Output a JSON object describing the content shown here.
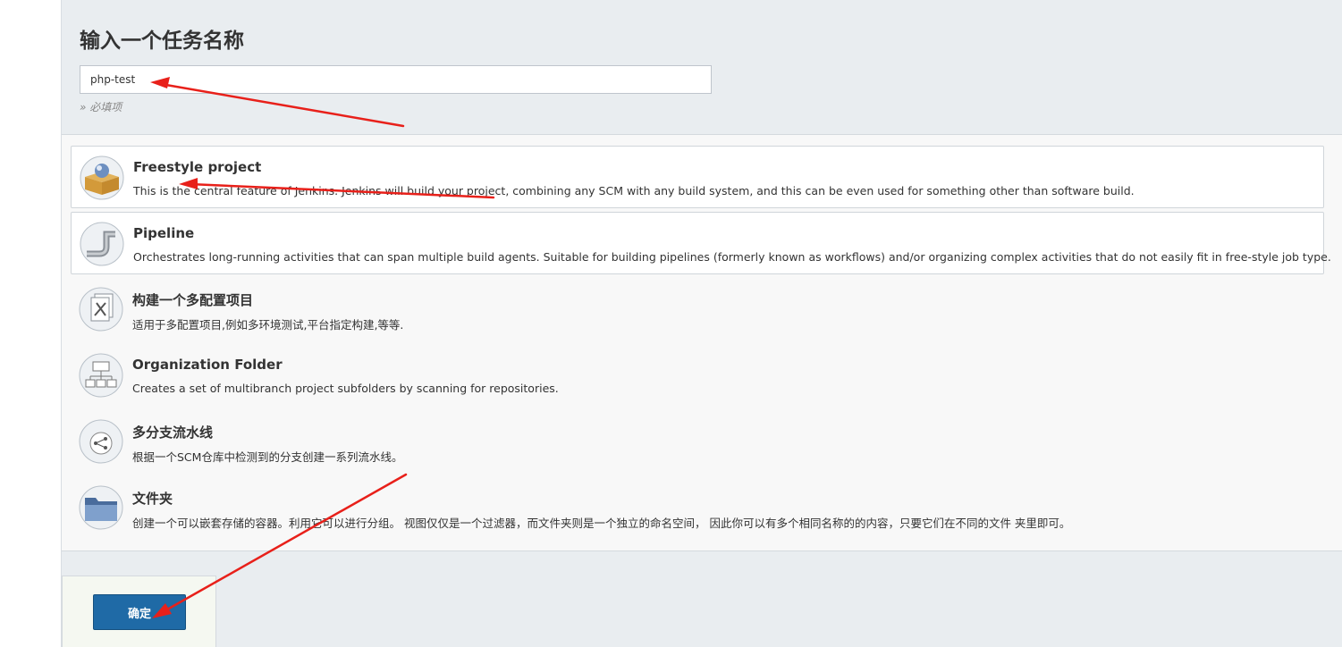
{
  "page": {
    "title": "输入一个任务名称",
    "name_input_value": "php-test",
    "required_hint": "» 必填项"
  },
  "job_types": [
    {
      "title": "Freestyle project",
      "description": "This is the central feature of Jenkins. Jenkins will build your project, combining any SCM with any build system, and this can be even used for something other than software build.",
      "icon": "freestyle-box-icon"
    },
    {
      "title": "Pipeline",
      "description": "Orchestrates long-running activities that can span multiple build agents. Suitable for building pipelines (formerly known as workflows) and/or organizing complex activities that do not easily fit in free-style job type.",
      "icon": "pipeline-icon"
    },
    {
      "title": "构建一个多配置项目",
      "description": "适用于多配置项目,例如多环境测试,平台指定构建,等等.",
      "icon": "multi-config-icon"
    },
    {
      "title": "Organization Folder",
      "description": "Creates a set of multibranch project subfolders by scanning for repositories.",
      "icon": "organization-folder-icon"
    },
    {
      "title": "多分支流水线",
      "description": "根据一个SCM仓库中检测到的分支创建一系列流水线。",
      "icon": "multibranch-pipeline-icon"
    },
    {
      "title": "文件夹",
      "description": "创建一个可以嵌套存储的容器。利用它可以进行分组。 视图仅仅是一个过滤器，而文件夹则是一个独立的命名空间， 因此你可以有多个相同名称的的内容，只要它们在不同的文件 夹里即可。",
      "icon": "folder-icon"
    }
  ],
  "footer": {
    "ok_label": "确定"
  },
  "colors": {
    "header_bg": "#e9edf0",
    "ok_button": "#1f6aa6",
    "annotation_arrow": "#e8201a"
  }
}
